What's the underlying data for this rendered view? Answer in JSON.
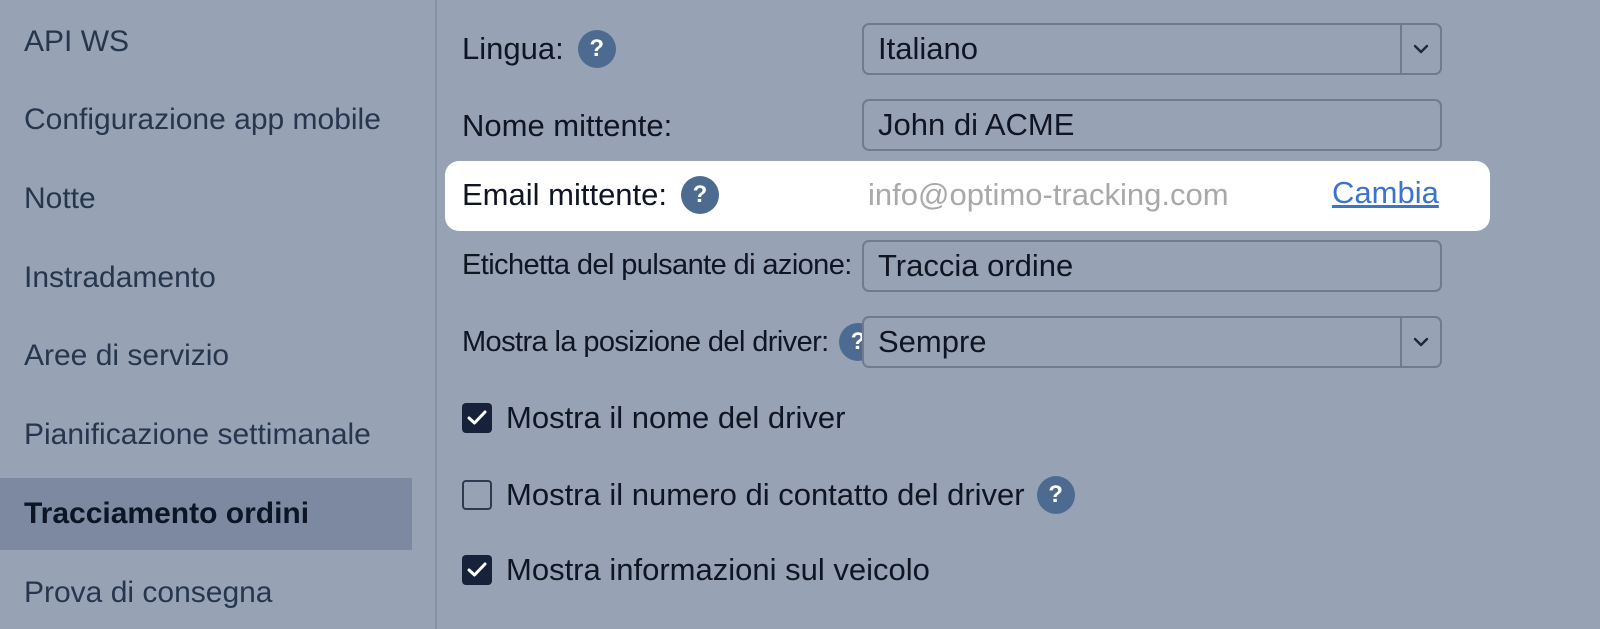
{
  "sidebar": {
    "items": [
      {
        "label": "API WS"
      },
      {
        "label": "Configurazione app mobile"
      },
      {
        "label": "Notte"
      },
      {
        "label": "Instradamento"
      },
      {
        "label": "Aree di servizio"
      },
      {
        "label": "Pianificazione settimanale"
      },
      {
        "label": "Tracciamento ordini",
        "active": true
      },
      {
        "label": "Prova di consegna"
      }
    ]
  },
  "form": {
    "language": {
      "label": "Lingua:",
      "value": "Italiano"
    },
    "sender_name": {
      "label": "Nome mittente:",
      "value": "John di ACME"
    },
    "sender_email": {
      "label": "Email mittente:",
      "value": "info@optimo-tracking.com",
      "change_label": "Cambia"
    },
    "action_button_label": {
      "label": "Etichetta del pulsante di azione:",
      "value": "Traccia ordine"
    },
    "driver_position": {
      "label": "Mostra la posizione del driver:",
      "value": "Sempre"
    },
    "checkboxes": [
      {
        "label": "Mostra il nome del driver",
        "checked": true
      },
      {
        "label": "Mostra il numero di contatto del driver",
        "checked": false
      },
      {
        "label": "Mostra informazioni sul veicolo",
        "checked": true
      }
    ]
  },
  "icons": {
    "help": "?",
    "help_name": "help-icon",
    "chevron": "chevron-down-icon",
    "check": "checkmark-icon"
  },
  "colors": {
    "background": "#97a2b4",
    "active_item": "#7c89a0",
    "help_icon": "#4d6a90",
    "link": "#3b74c9",
    "highlight": "#ffffff"
  }
}
